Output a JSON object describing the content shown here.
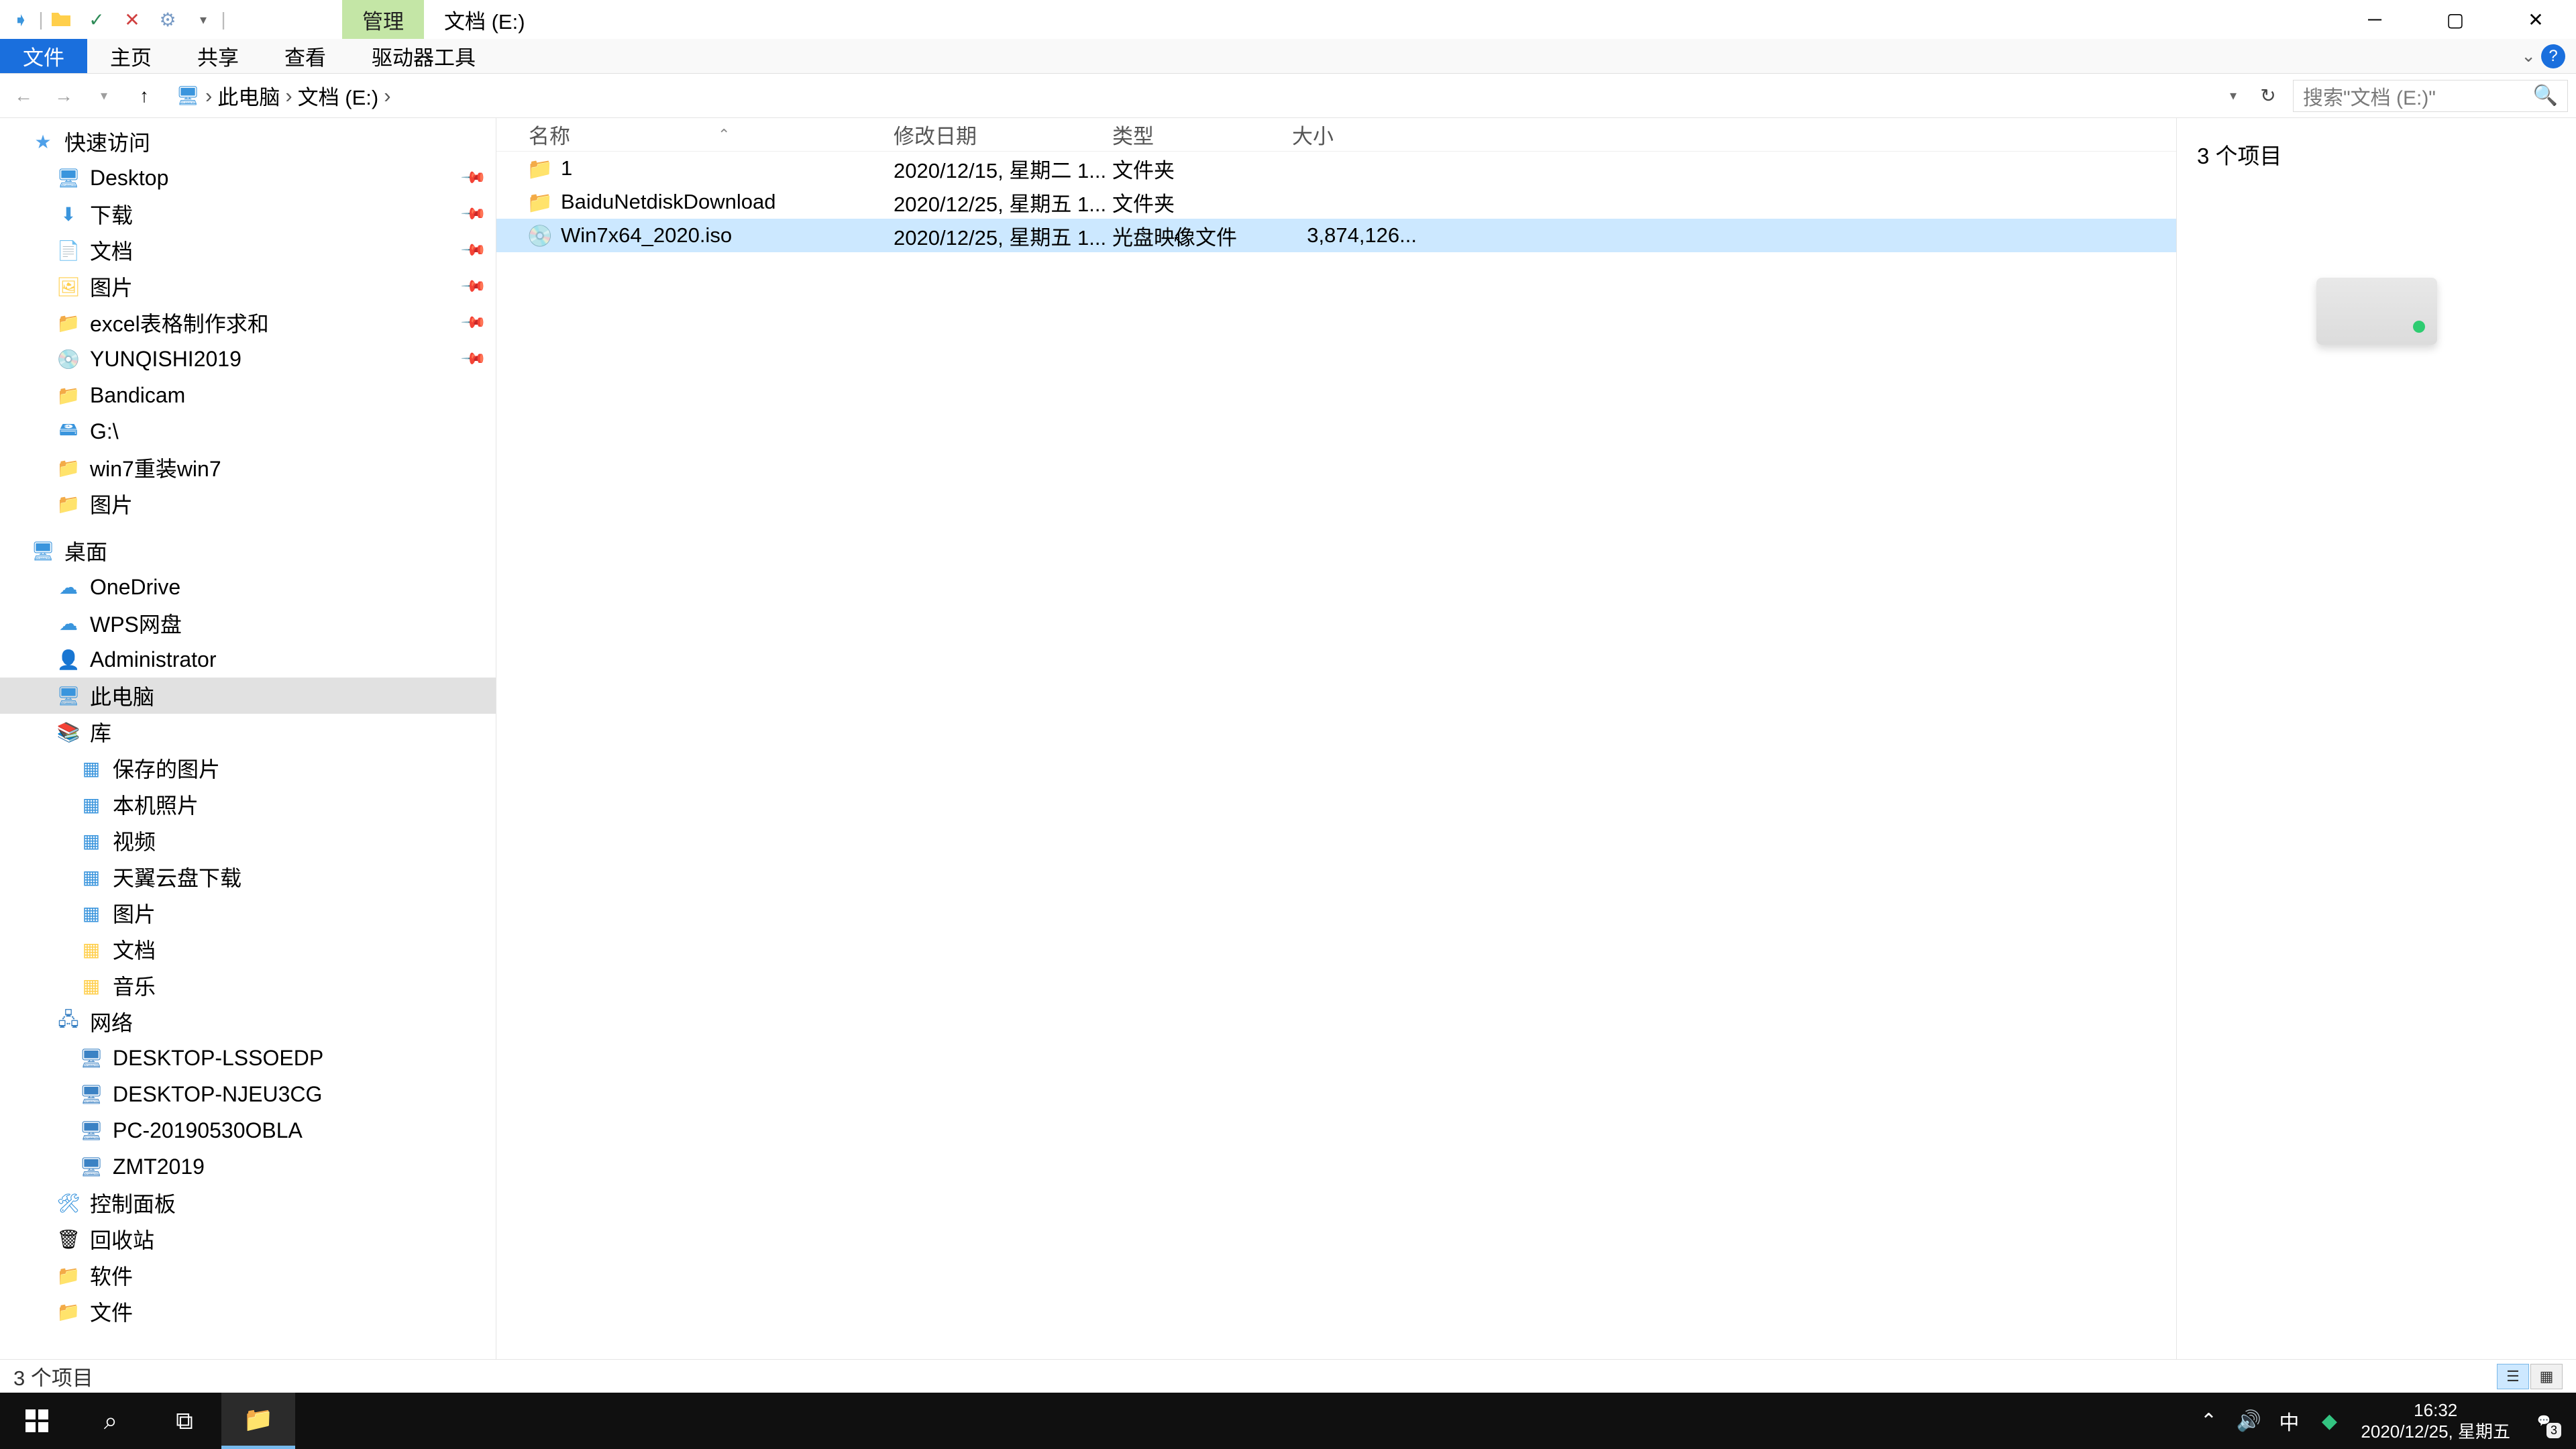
{
  "titlebar": {
    "manage_tab": "管理",
    "title": "文档 (E:)"
  },
  "ribbon": {
    "file": "文件",
    "home": "主页",
    "share": "共享",
    "view": "查看",
    "drive_tools": "驱动器工具"
  },
  "address": {
    "crumbs": [
      "此电脑",
      "文档 (E:)"
    ],
    "search_placeholder": "搜索\"文档 (E:)\""
  },
  "tree": {
    "quick_access": "快速访问",
    "quick_items": [
      {
        "label": "Desktop",
        "icon": "desktop",
        "pinned": true,
        "color": "c-blue"
      },
      {
        "label": "下载",
        "icon": "download",
        "pinned": true,
        "color": "c-blue"
      },
      {
        "label": "文档",
        "icon": "doc",
        "pinned": true,
        "color": "c-folder"
      },
      {
        "label": "图片",
        "icon": "pic",
        "pinned": true,
        "color": "c-folder"
      },
      {
        "label": "excel表格制作求和",
        "icon": "folder",
        "pinned": true,
        "color": "c-folder"
      },
      {
        "label": "YUNQISHI2019",
        "icon": "disc",
        "pinned": true,
        "color": "c-blue"
      },
      {
        "label": "Bandicam",
        "icon": "folder",
        "pinned": false,
        "color": "c-folder"
      },
      {
        "label": "G:\\",
        "icon": "drive",
        "pinned": false,
        "color": "c-blue"
      },
      {
        "label": "win7重装win7",
        "icon": "folder",
        "pinned": false,
        "color": "c-folder"
      },
      {
        "label": "图片",
        "icon": "folder",
        "pinned": false,
        "color": "c-folder"
      }
    ],
    "desktop": "桌面",
    "desktop_items": [
      {
        "label": "OneDrive",
        "icon": "cloud",
        "color": "c-blue"
      },
      {
        "label": "WPS网盘",
        "icon": "cloud",
        "color": "c-blue"
      },
      {
        "label": "Administrator",
        "icon": "user",
        "color": "c-folder"
      },
      {
        "label": "此电脑",
        "icon": "pc",
        "color": "c-blue",
        "selected": true
      },
      {
        "label": "库",
        "icon": "lib",
        "color": "c-folder"
      }
    ],
    "lib_items": [
      {
        "label": "保存的图片",
        "color": "c-blue"
      },
      {
        "label": "本机照片",
        "color": "c-blue"
      },
      {
        "label": "视频",
        "color": "c-blue"
      },
      {
        "label": "天翼云盘下载",
        "color": "c-blue"
      },
      {
        "label": "图片",
        "color": "c-blue"
      },
      {
        "label": "文档",
        "color": "c-folder"
      },
      {
        "label": "音乐",
        "color": "c-folder"
      }
    ],
    "network": "网络",
    "network_items": [
      "DESKTOP-LSSOEDP",
      "DESKTOP-NJEU3CG",
      "PC-20190530OBLA",
      "ZMT2019"
    ],
    "control_panel": "控制面板",
    "recycle_bin": "回收站",
    "software": "软件",
    "docs_folder": "文件"
  },
  "list": {
    "headers": {
      "name": "名称",
      "date": "修改日期",
      "type": "类型",
      "size": "大小"
    },
    "rows": [
      {
        "name": "1",
        "date": "2020/12/15, 星期二 1...",
        "type": "文件夹",
        "size": "",
        "icon": "folder",
        "selected": false
      },
      {
        "name": "BaiduNetdiskDownload",
        "date": "2020/12/25, 星期五 1...",
        "type": "文件夹",
        "size": "",
        "icon": "folder",
        "selected": false
      },
      {
        "name": "Win7x64_2020.iso",
        "date": "2020/12/25, 星期五 1...",
        "type": "光盘映像文件",
        "size": "3,874,126...",
        "icon": "iso",
        "selected": true
      }
    ]
  },
  "preview": {
    "count_label": "3 个项目"
  },
  "status": {
    "text": "3 个项目"
  },
  "taskbar": {
    "time": "16:32",
    "date": "2020/12/25, 星期五",
    "ime": "中",
    "notif_count": "3"
  }
}
